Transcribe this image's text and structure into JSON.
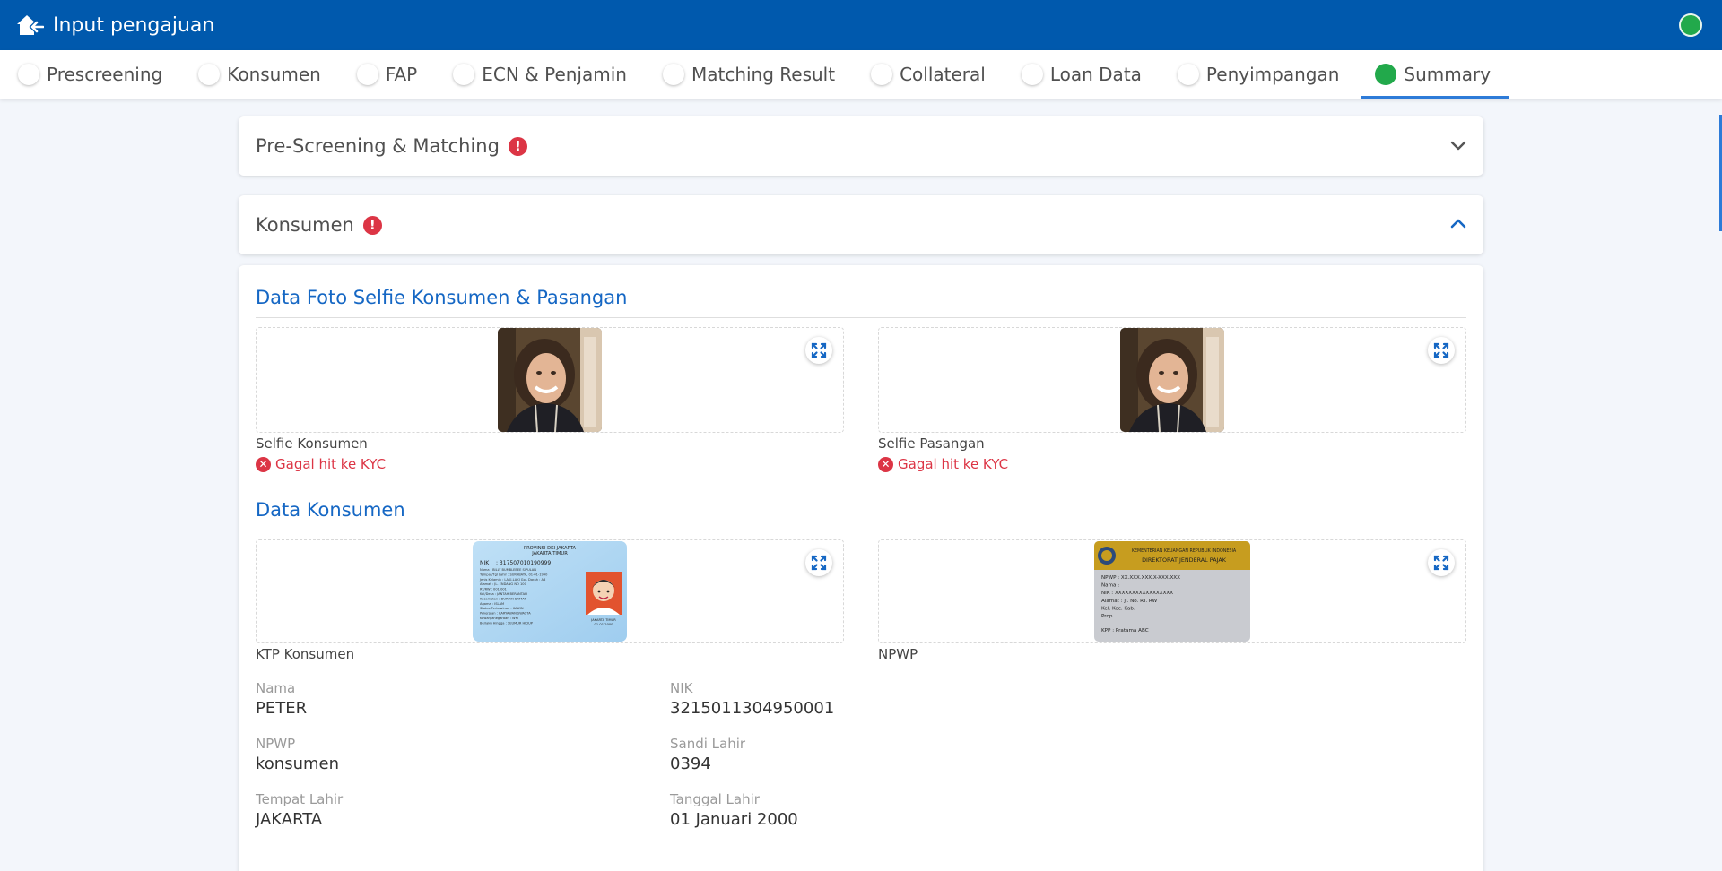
{
  "header": {
    "title": "Input pengajuan",
    "status_color": "#22a94b",
    "home_icon": "home-back-icon"
  },
  "tabs": [
    {
      "label": "Prescreening",
      "active": false
    },
    {
      "label": "Konsumen",
      "active": false
    },
    {
      "label": "FAP",
      "active": false
    },
    {
      "label": "ECN & Penjamin",
      "active": false
    },
    {
      "label": "Matching Result",
      "active": false
    },
    {
      "label": "Collateral",
      "active": false
    },
    {
      "label": "Loan Data",
      "active": false
    },
    {
      "label": "Penyimpangan",
      "active": false
    },
    {
      "label": "Summary",
      "active": true
    }
  ],
  "accordions": {
    "prescreening": {
      "title": "Pre-Screening & Matching",
      "alert": "!",
      "expanded": false
    },
    "konsumen": {
      "title": "Konsumen",
      "alert": "!",
      "expanded": true
    }
  },
  "selfie_section": {
    "title": "Data Foto Selfie Konsumen & Pasangan",
    "items": [
      {
        "label": "Selfie Konsumen",
        "status": "Gagal hit ke KYC"
      },
      {
        "label": "Selfie Pasangan",
        "status": "Gagal hit ke KYC"
      }
    ]
  },
  "konsumen_section": {
    "title": "Data Konsumen",
    "docs": [
      {
        "label": "KTP Konsumen"
      },
      {
        "label": "NPWP"
      }
    ],
    "ktp_card": {
      "provinsi": "PROVINSI DKI JAKARTA",
      "kota": "JAKARTA TIMUR",
      "nik_label": "NIK",
      "nik": ": 317507010190999",
      "rows": [
        "Nama : BILLY BUMBLEBEE SIPULAN",
        "Tempat/Tgl Lahir : SURABAYA, 01-01-1990",
        "Jenis Kelamin : LAKI-LAKI   Gol. Darah : AB",
        "Alamat : JL. ENDANG NO 100",
        "RT/RW : 001/001",
        "Kel/Desa : JANTAH BERANTAH",
        "Kecamatan : DURIAN DAMAT",
        "Agama : ISLAM",
        "Status Perkawinan : KAWIN",
        "Pekerjaan : KARYAWAN SWASTA",
        "Kewarganegaraan : WNI",
        "Berlaku Hingga : SEUMUR HIDUP"
      ],
      "sign_city": "JAKARTA TIMUR",
      "sign_date": "01-01-2000"
    },
    "npwp_card": {
      "line1": "KEMENTERIAN KEUANGAN REPUBLIK INDONESIA",
      "line2": "DIREKTORAT JENDERAL PAJAK",
      "rows": [
        "NPWP : XX.XXX.XXX.X-XXX.XXX",
        "Nama :",
        "NIK : XXXXXXXXXXXXXXXXX",
        "Alamat : Jl.          No.     RT.   RW",
        "Kel.              Kec.            Kab.",
        "Prop."
      ],
      "kpp": "KPP   : Pratama ABC"
    },
    "fields": [
      {
        "label": "Nama",
        "value": "PETER"
      },
      {
        "label": "NIK",
        "value": "3215011304950001"
      },
      {
        "label": "NPWP",
        "value": "konsumen"
      },
      {
        "label": "Sandi Lahir",
        "value": "0394"
      },
      {
        "label": "Tempat Lahir",
        "value": "JAKARTA"
      },
      {
        "label": "Tanggal Lahir",
        "value": "01 Januari 2000"
      }
    ]
  }
}
